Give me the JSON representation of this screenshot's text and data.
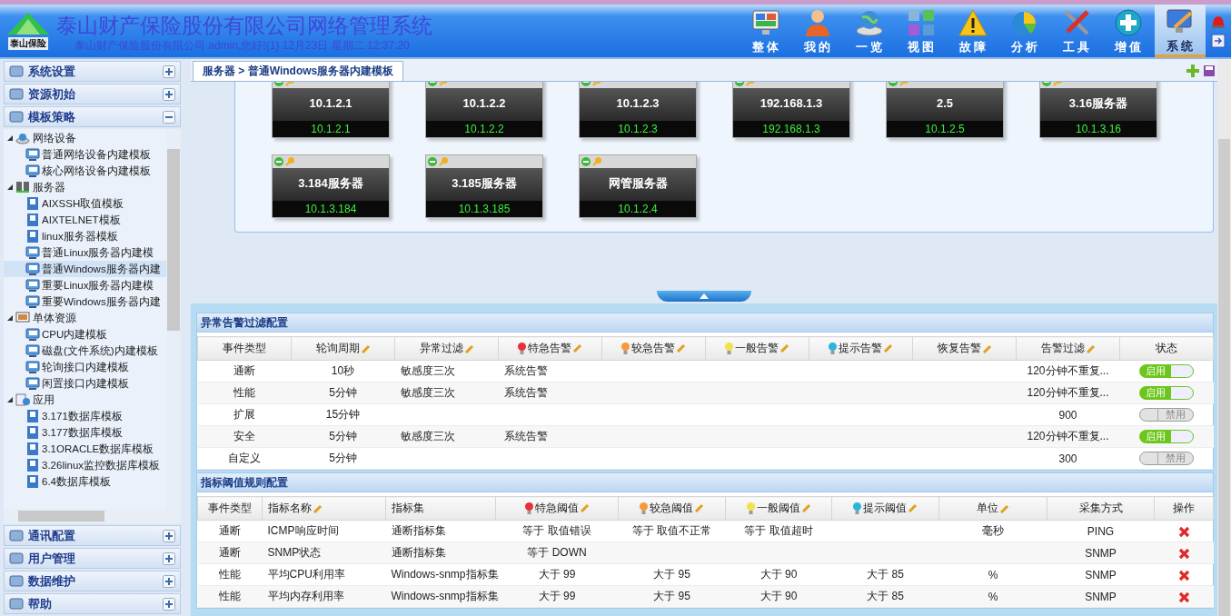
{
  "header": {
    "logo_text": "泰山保险",
    "title": "泰山财产保险股份有限公司网络管理系统",
    "subtitle": "泰山财产保险股份有限公司 admin,您好!(1) 12月23日 星期二 12:37:20"
  },
  "nav": [
    {
      "label": "整 体",
      "kind": "monitor",
      "selected": false
    },
    {
      "label": "我 的",
      "kind": "person",
      "selected": false
    },
    {
      "label": "一 览",
      "kind": "globe",
      "selected": false
    },
    {
      "label": "视 图",
      "kind": "grid",
      "selected": false
    },
    {
      "label": "故 障",
      "kind": "warning",
      "selected": false
    },
    {
      "label": "分 析",
      "kind": "pie",
      "selected": false
    },
    {
      "label": "工 具",
      "kind": "tools",
      "selected": false
    },
    {
      "label": "增 值",
      "kind": "plus",
      "selected": false
    },
    {
      "label": "系 统",
      "kind": "settings",
      "selected": true
    }
  ],
  "sidebar": {
    "top_sections": [
      {
        "label": "系统设置",
        "expanded": false
      },
      {
        "label": "资源初始",
        "expanded": false
      },
      {
        "label": "模板策略",
        "expanded": true
      }
    ],
    "tree": [
      {
        "label": "网络设备",
        "kind": "network",
        "expanded": true,
        "selected": false,
        "children": [
          {
            "label": "普通网络设备内建模板",
            "kind": "builtin",
            "selected": false
          },
          {
            "label": "核心网络设备内建模板",
            "kind": "builtin",
            "selected": false
          }
        ]
      },
      {
        "label": "服务器",
        "kind": "server",
        "expanded": true,
        "selected": false,
        "children": [
          {
            "label": "AIXSSH取值模板",
            "kind": "custom",
            "selected": false
          },
          {
            "label": "AIXTELNET模板",
            "kind": "custom",
            "selected": false
          },
          {
            "label": "linux服务器模板",
            "kind": "custom",
            "selected": false
          },
          {
            "label": "普通Linux服务器内建模",
            "kind": "builtin",
            "selected": false
          },
          {
            "label": "普通Windows服务器内建",
            "kind": "builtin",
            "selected": true
          },
          {
            "label": "重要Linux服务器内建模",
            "kind": "builtin",
            "selected": false
          },
          {
            "label": "重要Windows服务器内建",
            "kind": "builtin",
            "selected": false
          }
        ]
      },
      {
        "label": "单体资源",
        "kind": "resource",
        "expanded": true,
        "selected": false,
        "children": [
          {
            "label": "CPU内建模板",
            "kind": "builtin",
            "selected": false
          },
          {
            "label": "磁盘(文件系统)内建模板",
            "kind": "builtin",
            "selected": false
          },
          {
            "label": "轮询接口内建模板",
            "kind": "builtin",
            "selected": false
          },
          {
            "label": "闲置接口内建模板",
            "kind": "builtin",
            "selected": false
          }
        ]
      },
      {
        "label": "应用",
        "kind": "app",
        "expanded": true,
        "selected": false,
        "children": [
          {
            "label": "3.171数据库模板",
            "kind": "custom",
            "selected": false
          },
          {
            "label": "3.177数据库模板",
            "kind": "custom",
            "selected": false
          },
          {
            "label": "3.1ORACLE数据库模板",
            "kind": "custom",
            "selected": false
          },
          {
            "label": "3.26linux监控数据库模板",
            "kind": "custom",
            "selected": false
          },
          {
            "label": "6.4数据库模板",
            "kind": "custom",
            "selected": false
          }
        ]
      }
    ],
    "bottom_sections": [
      {
        "label": "通讯配置",
        "expanded": false
      },
      {
        "label": "用户管理",
        "expanded": false
      },
      {
        "label": "数据维护",
        "expanded": false
      },
      {
        "label": "帮助",
        "expanded": false
      }
    ]
  },
  "breadcrumb": "服务器 > 普通Windows服务器内建模板",
  "devices": [
    {
      "name": "10.1.2.1",
      "ip": "10.1.2.1"
    },
    {
      "name": "10.1.2.2",
      "ip": "10.1.2.2"
    },
    {
      "name": "10.1.2.3",
      "ip": "10.1.2.3"
    },
    {
      "name": "192.168.1.3",
      "ip": "192.168.1.3"
    },
    {
      "name": "2.5",
      "ip": "10.1.2.5"
    },
    {
      "name": "3.16服务器",
      "ip": "10.1.3.16"
    },
    {
      "name": "3.184服务器",
      "ip": "10.1.3.184"
    },
    {
      "name": "3.185服务器",
      "ip": "10.1.3.185"
    },
    {
      "name": "网管服务器",
      "ip": "10.1.2.4"
    }
  ],
  "alarm_filter": {
    "title": "异常告警过滤配置",
    "columns": [
      {
        "label": "事件类型",
        "editable": false
      },
      {
        "label": "轮询周期",
        "editable": true
      },
      {
        "label": "异常过滤",
        "editable": true
      },
      {
        "label": "特急告警",
        "editable": true,
        "color": "#e8303a"
      },
      {
        "label": "较急告警",
        "editable": true,
        "color": "#f59a3c"
      },
      {
        "label": "一般告警",
        "editable": true,
        "color": "#f2e14a"
      },
      {
        "label": "提示告警",
        "editable": true,
        "color": "#2bb5d8"
      },
      {
        "label": "恢复告警",
        "editable": true
      },
      {
        "label": "告警过滤",
        "editable": true
      },
      {
        "label": "状态",
        "editable": false
      }
    ],
    "rows": [
      {
        "cells": [
          "通断",
          "10秒",
          "敏感度三次",
          "系统告警",
          "",
          "",
          "",
          "",
          "120分钟不重复..."
        ],
        "on": true,
        "status": "启用"
      },
      {
        "cells": [
          "性能",
          "5分钟",
          "敏感度三次",
          "系统告警",
          "",
          "",
          "",
          "",
          "120分钟不重复..."
        ],
        "on": true,
        "status": "启用"
      },
      {
        "cells": [
          "扩展",
          "15分钟",
          "",
          "",
          "",
          "",
          "",
          "",
          "900"
        ],
        "on": false,
        "status": "禁用"
      },
      {
        "cells": [
          "安全",
          "5分钟",
          "敏感度三次",
          "系统告警",
          "",
          "",
          "",
          "",
          "120分钟不重复..."
        ],
        "on": true,
        "status": "启用"
      },
      {
        "cells": [
          "自定义",
          "5分钟",
          "",
          "",
          "",
          "",
          "",
          "",
          "300"
        ],
        "on": false,
        "status": "禁用"
      }
    ]
  },
  "thresholds": {
    "title": "指标阈值规则配置",
    "columns": [
      {
        "label": "事件类型",
        "editable": false
      },
      {
        "label": "指标名称",
        "editable": true
      },
      {
        "label": "指标集",
        "editable": false
      },
      {
        "label": "特急阈值",
        "editable": true,
        "color": "#e8303a"
      },
      {
        "label": "较急阈值",
        "editable": true,
        "color": "#f59a3c"
      },
      {
        "label": "一般阈值",
        "editable": true,
        "color": "#f2e14a"
      },
      {
        "label": "提示阈值",
        "editable": true,
        "color": "#2bb5d8"
      },
      {
        "label": "单位",
        "editable": true
      },
      {
        "label": "采集方式",
        "editable": false
      },
      {
        "label": "操作",
        "editable": false
      }
    ],
    "rows": [
      {
        "cells": [
          "通断",
          "ICMP响应时间",
          "通断指标集",
          "等于 取值错误",
          "等于 取值不正常",
          "等于 取值超时",
          "",
          "毫秒",
          "PING"
        ]
      },
      {
        "cells": [
          "通断",
          "SNMP状态",
          "通断指标集",
          "等于 DOWN",
          "",
          "",
          "",
          "",
          "SNMP"
        ]
      },
      {
        "cells": [
          "性能",
          "平均CPU利用率",
          "Windows-snmp指标集",
          "大于 99",
          "大于 95",
          "大于 90",
          "大于 85",
          "%",
          "SNMP"
        ]
      },
      {
        "cells": [
          "性能",
          "平均内存利用率",
          "Windows-snmp指标集",
          "大于 99",
          "大于 95",
          "大于 90",
          "大于 85",
          "%",
          "SNMP"
        ]
      }
    ]
  }
}
